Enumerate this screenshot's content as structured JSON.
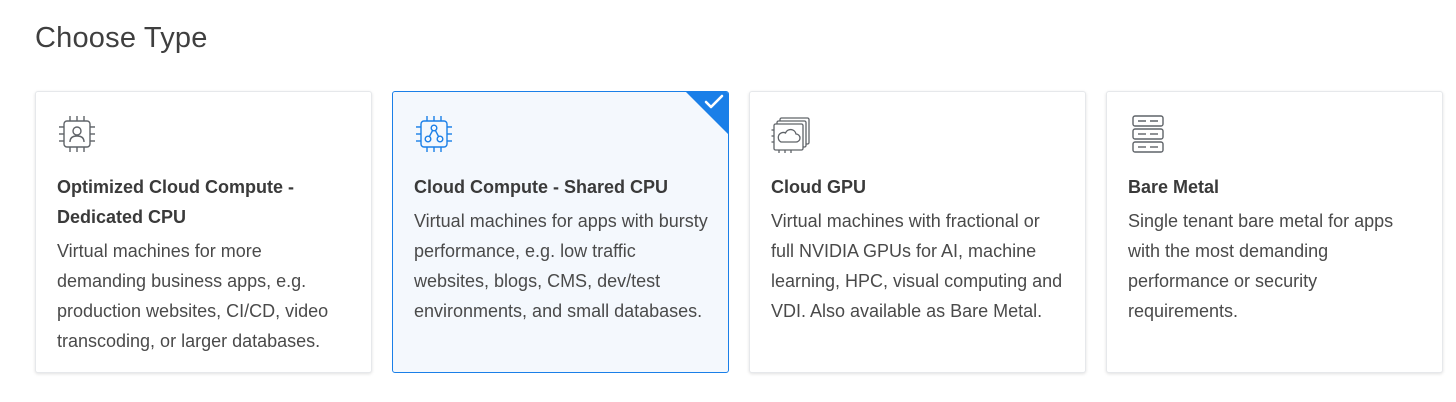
{
  "section": {
    "title": "Choose Type"
  },
  "cards": [
    {
      "icon": "cpu-user-chip-icon",
      "title": "Optimized Cloud Compute - Dedicated CPU",
      "description": "Virtual machines for more demanding business apps, e.g. production websites, CI/CD, video transcoding, or larger databases.",
      "selected": false
    },
    {
      "icon": "cpu-network-chip-icon",
      "title": "Cloud Compute - Shared CPU",
      "description": "Virtual machines for apps with bursty performance, e.g. low traffic websites, blogs, CMS, dev/test environments, and small databases.",
      "selected": true
    },
    {
      "icon": "gpu-cloud-icon",
      "title": "Cloud GPU",
      "description": "Virtual machines with fractional or full NVIDIA GPUs for AI, machine learning, HPC, visual computing and VDI. Also available as Bare Metal.",
      "selected": false
    },
    {
      "icon": "server-rack-icon",
      "title": "Bare Metal",
      "description": "Single tenant bare metal for apps with the most demanding performance or security requirements.",
      "selected": false
    }
  ],
  "colors": {
    "accent": "#1a7fe8",
    "selected_bg": "#f4f8fd",
    "icon_gray": "#5f6368"
  }
}
